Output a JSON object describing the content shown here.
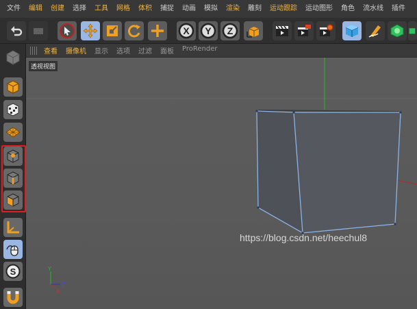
{
  "menubar": {
    "items": [
      {
        "label": "文件",
        "highlight": false
      },
      {
        "label": "编辑",
        "highlight": true
      },
      {
        "label": "创建",
        "highlight": true
      },
      {
        "label": "选择",
        "highlight": false
      },
      {
        "label": "工具",
        "highlight": true
      },
      {
        "label": "网格",
        "highlight": true
      },
      {
        "label": "体积",
        "highlight": true
      },
      {
        "label": "捕捉",
        "highlight": false
      },
      {
        "label": "动画",
        "highlight": false
      },
      {
        "label": "模拟",
        "highlight": false
      },
      {
        "label": "渲染",
        "highlight": true
      },
      {
        "label": "雕刻",
        "highlight": false
      },
      {
        "label": "运动跟踪",
        "highlight": true
      },
      {
        "label": "运动图形",
        "highlight": false
      },
      {
        "label": "角色",
        "highlight": false
      },
      {
        "label": "流水线",
        "highlight": false
      },
      {
        "label": "插件",
        "highlight": false
      }
    ]
  },
  "toolbar": {
    "tools": [
      "undo-icon",
      "redo-icon",
      "select-icon",
      "move-icon",
      "scale-icon",
      "rotate-icon",
      "recent-tool-icon",
      "x-axis-icon",
      "y-axis-icon",
      "z-axis-icon",
      "coordinate-system-icon",
      "render-view-icon",
      "render-picture-viewer-icon",
      "render-settings-icon",
      "cube-object-icon",
      "pen-spline-icon",
      "subdivision-icon",
      "array-icon"
    ],
    "axis_letters": {
      "x": "X",
      "y": "Y",
      "z": "Z"
    }
  },
  "palette": {
    "tools": [
      "make-editable-icon",
      "model-mode-icon",
      "texture-mode-icon",
      "workplane-icon",
      "points-mode-icon",
      "edges-mode-icon",
      "polygons-mode-icon",
      "axis-mode-icon",
      "tweak-mode-icon",
      "solo-icon",
      "snap-magnet-icon"
    ],
    "solo_letter": "S"
  },
  "viewport": {
    "menus": [
      {
        "label": "查看",
        "highlight": true
      },
      {
        "label": "摄像机",
        "highlight": true
      },
      {
        "label": "显示",
        "highlight": false
      },
      {
        "label": "选项",
        "highlight": false
      },
      {
        "label": "过滤",
        "highlight": false
      },
      {
        "label": "面板",
        "highlight": false
      },
      {
        "label": "ProRender",
        "highlight": false
      }
    ],
    "view_label": "透视视图",
    "axis_gizmo": {
      "x": "X",
      "y": "Y",
      "z": "Z"
    },
    "colors": {
      "edge": "#8ab4e8",
      "cube_front": "#54575d",
      "cube_side": "#4e5157",
      "x_axis": "#c03030",
      "y_axis": "#30b030"
    }
  },
  "watermark": "https://blog.csdn.net/heechul8",
  "colors": {
    "accent_orange": "#f0b440",
    "selected_blue": "#9ab6e2",
    "highlight_red": "#e02020"
  }
}
